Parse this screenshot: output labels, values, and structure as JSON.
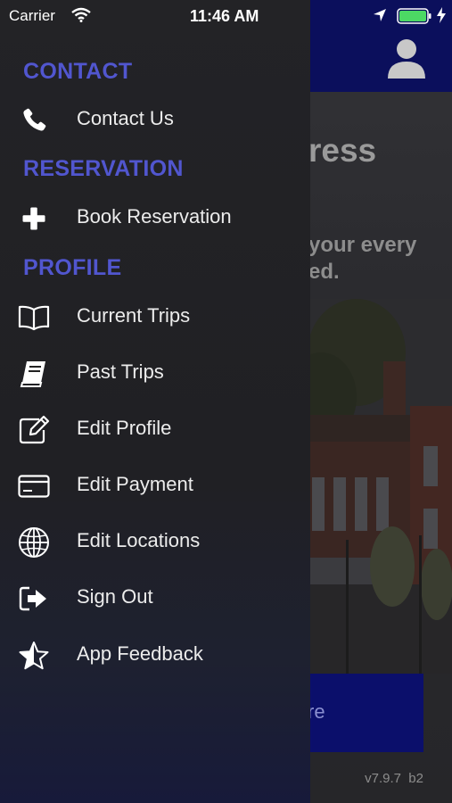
{
  "status_bar": {
    "carrier": "Carrier",
    "time": "11:46 AM"
  },
  "background": {
    "title_fragment": "ress",
    "subtitle_line1": "your every",
    "subtitle_line2": "ed.",
    "button_fragment": "re",
    "version": "v7.9.7  b2",
    "header_color": "#0b0f5c"
  },
  "drawer": {
    "accent_color": "#5156cf",
    "sections": [
      {
        "header": "CONTACT",
        "items": [
          {
            "label": "Contact Us",
            "icon": "phone-icon"
          }
        ]
      },
      {
        "header": "RESERVATION",
        "items": [
          {
            "label": "Book Reservation",
            "icon": "plus-icon"
          }
        ]
      },
      {
        "header": "PROFILE",
        "items": [
          {
            "label": "Current Trips",
            "icon": "open-book-icon"
          },
          {
            "label": "Past Trips",
            "icon": "closed-book-icon"
          },
          {
            "label": "Edit Profile",
            "icon": "edit-square-icon"
          },
          {
            "label": "Edit Payment",
            "icon": "credit-card-icon"
          },
          {
            "label": "Edit Locations",
            "icon": "globe-icon"
          },
          {
            "label": "Sign Out",
            "icon": "sign-out-icon"
          },
          {
            "label": "App Feedback",
            "icon": "star-icon"
          }
        ]
      }
    ]
  }
}
